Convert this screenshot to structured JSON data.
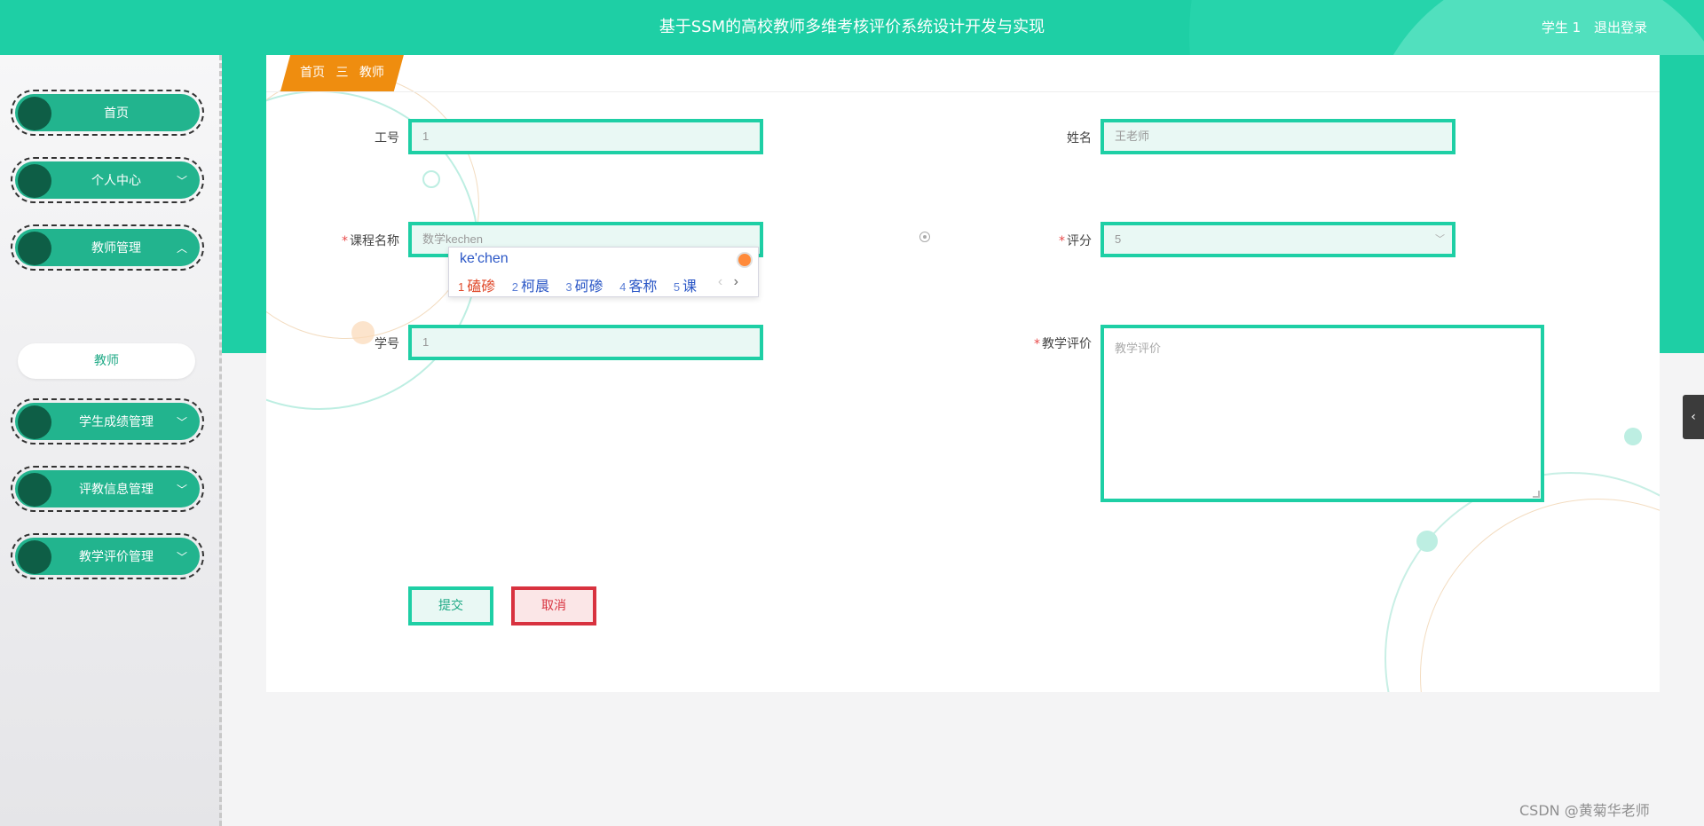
{
  "header": {
    "title": "基于SSM的高校教师多维考核评价系统设计开发与实现",
    "user_label": "学生 1",
    "logout_label": "退出登录"
  },
  "sidebar": {
    "items": [
      {
        "label": "首页",
        "chevron": ""
      },
      {
        "label": "个人中心",
        "chevron": "﹀"
      },
      {
        "label": "教师管理",
        "chevron": "︿"
      },
      {
        "label": "学生成绩管理",
        "chevron": "﹀"
      },
      {
        "label": "评教信息管理",
        "chevron": "﹀"
      },
      {
        "label": "教学评价管理",
        "chevron": "﹀"
      }
    ],
    "submenu_label": "教师"
  },
  "breadcrumb": {
    "home": "首页",
    "separator": "三",
    "current": "教师"
  },
  "form": {
    "gonghao": {
      "label": "工号",
      "value": "1"
    },
    "xingming": {
      "label": "姓名",
      "value": "王老师"
    },
    "kecheng": {
      "label": "课程名称",
      "value": "数学kechen"
    },
    "pingfen": {
      "label": "评分",
      "value": "5"
    },
    "xuehao": {
      "label": "学号",
      "value": "1"
    },
    "jiaoxuepingjia": {
      "label": "教学评价",
      "placeholder": "教学评价"
    },
    "required_mark": "*",
    "submit_label": "提交",
    "cancel_label": "取消"
  },
  "ime": {
    "composition": "ke'chen",
    "candidates": [
      {
        "n": "1",
        "text": "磕碜"
      },
      {
        "n": "2",
        "text": "柯晨"
      },
      {
        "n": "3",
        "text": "砢碜"
      },
      {
        "n": "4",
        "text": "客称"
      },
      {
        "n": "5",
        "text": "课"
      }
    ],
    "prev": "‹",
    "next": "›"
  },
  "sidetab_icon": "chevron-left-icon",
  "watermark": "CSDN @黄菊华老师",
  "colors": {
    "primary": "#1ecfa5",
    "breadcrumb": "#ef8d0f",
    "cancel": "#d8323f"
  }
}
